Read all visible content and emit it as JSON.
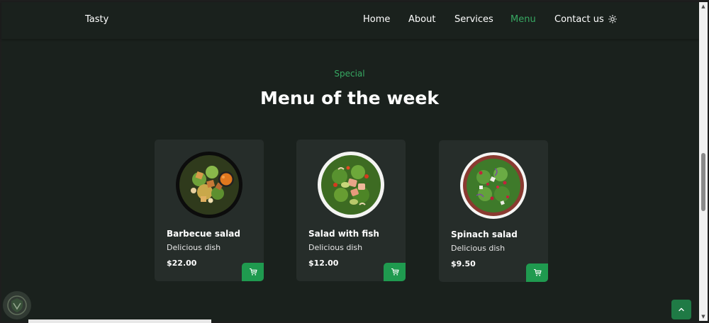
{
  "header": {
    "logo": "Tasty",
    "nav": [
      {
        "label": "Home",
        "active": false
      },
      {
        "label": "About",
        "active": false
      },
      {
        "label": "Services",
        "active": false
      },
      {
        "label": "Menu",
        "active": true
      },
      {
        "label": "Contact us",
        "active": false
      }
    ],
    "theme_icon": "sun-icon"
  },
  "section": {
    "subtitle": "Special",
    "title": "Menu of the week"
  },
  "cards": [
    {
      "name": "Barbecue salad",
      "desc": "Delicious dish",
      "price": "$22.00"
    },
    {
      "name": "Salad with fish",
      "desc": "Delicious dish",
      "price": "$12.00"
    },
    {
      "name": "Spinach salad",
      "desc": "Delicious dish",
      "price": "$9.50"
    }
  ],
  "colors": {
    "background": "#1a211d",
    "card": "#262d2a",
    "accent": "#37a862",
    "button": "#1f9a4f"
  },
  "icons": {
    "cart": "cart-icon",
    "scroll_top": "chevron-up-icon"
  }
}
